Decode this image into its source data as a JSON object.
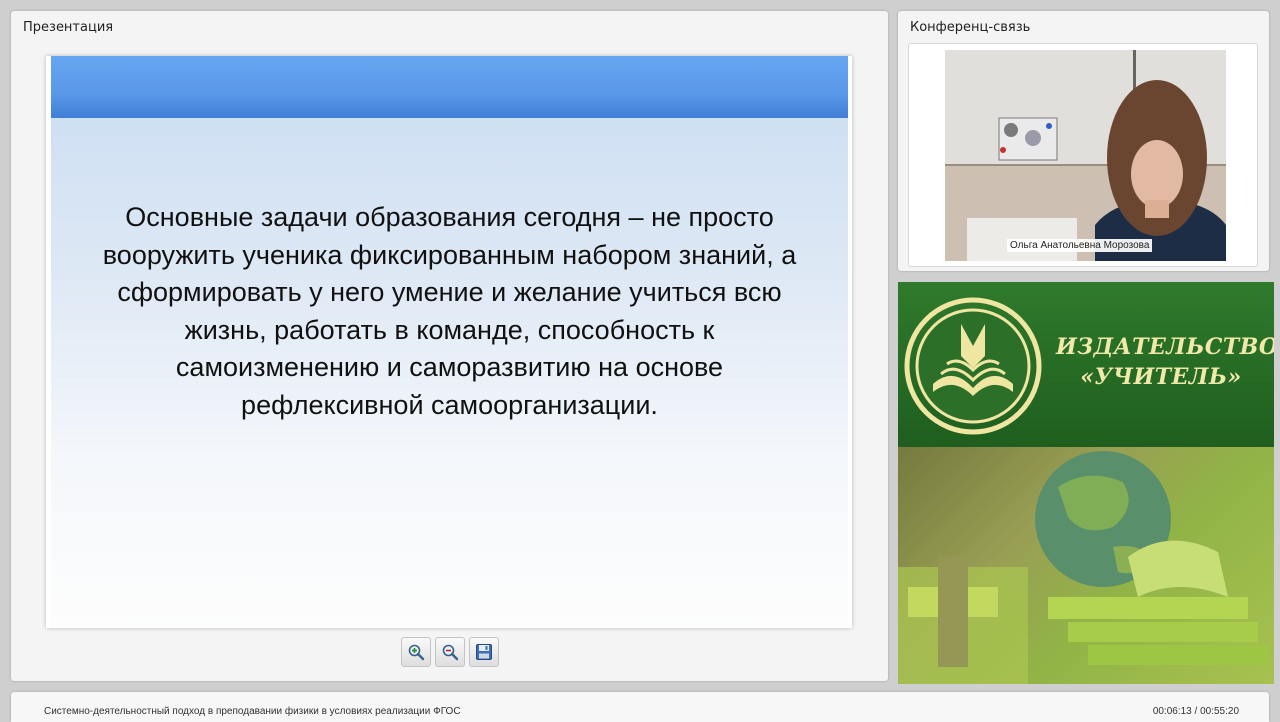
{
  "presentation": {
    "title": "Презентация",
    "slide_text": "Основные задачи образования сегодня – не просто вооружить ученика фиксированным набором знаний, а сформировать у него умение и желание учиться всю жизнь, работать в команде, способность к самоизменению и саморазвитию на основе рефлексивной самоорганизации.",
    "toolbar": {
      "zoom_in_icon": "zoom-in-icon",
      "zoom_out_icon": "zoom-out-icon",
      "save_icon": "floppy-disk-icon"
    }
  },
  "conference": {
    "title": "Конференц-связь",
    "participant_name": "Ольга Анатольевна Морозова"
  },
  "banner": {
    "publisher_line1": "ИЗДАТЕЛЬСТВО",
    "publisher_line2": "«УЧИТЕЛЬ»",
    "logo_icon": "open-book-emblem-icon"
  },
  "footer": {
    "title": "Системно-деятельностный подход в преподавании физики в условиях реализации ФГОС",
    "time": "00:06:13 / 00:55:20"
  },
  "colors": {
    "slide_bar": "#5a98e8",
    "banner_green": "#2a6f28",
    "banner_text": "#f1e9a9"
  }
}
